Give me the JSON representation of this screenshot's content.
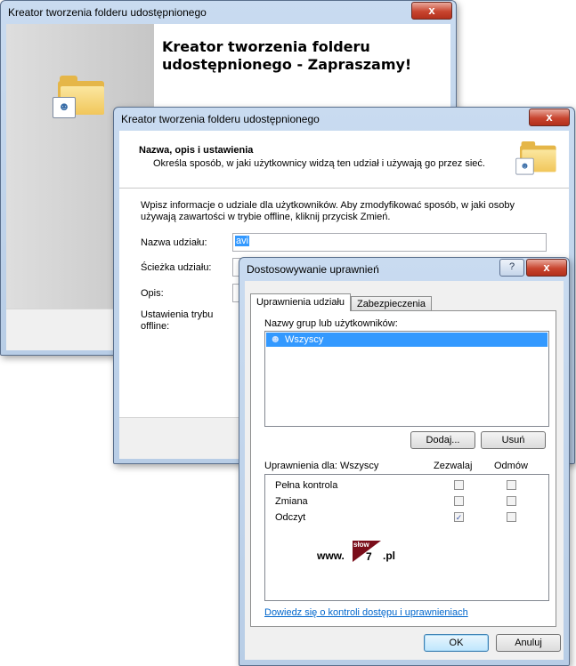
{
  "wizard1": {
    "title": "Kreator tworzenia folderu udostępnionego",
    "heading": "Kreator tworzenia folderu udostępnionego - Zapraszamy!",
    "close_label": "x"
  },
  "wizard2": {
    "title": "Kreator tworzenia folderu udostępnionego",
    "close_label": "x",
    "section_title": "Nazwa, opis i ustawienia",
    "section_desc": "Określa sposób, w jaki użytkownicy widzą ten udział i używają go przez sieć.",
    "instructions": "Wpisz informacje o udziale dla użytkowników. Aby zmodyfikować sposób, w jaki osoby używają zawartości w trybie offline, kliknij przycisk Zmień.",
    "fields": {
      "share_name_label": "Nazwa udziału:",
      "share_name_value": "avi",
      "share_path_label": "Ścieżka udziału:",
      "description_label": "Opis:",
      "offline_label": "Ustawienia trybu offline:"
    }
  },
  "permissions_dialog": {
    "title": "Dostosowywanie uprawnień",
    "help_label": "?",
    "close_label": "x",
    "tabs": [
      "Uprawnienia udziału",
      "Zabezpieczenia"
    ],
    "groups_label": "Nazwy grup lub użytkowników:",
    "groups": [
      "Wszyscy"
    ],
    "add_button": "Dodaj...",
    "remove_button": "Usuń",
    "permissions_for_label": "Uprawnienia dla: Wszyscy",
    "allow_header": "Zezwalaj",
    "deny_header": "Odmów",
    "permissions": [
      {
        "name": "Pełna kontrola",
        "allow": false,
        "deny": false
      },
      {
        "name": "Zmiana",
        "allow": false,
        "deny": false
      },
      {
        "name": "Odczyt",
        "allow": true,
        "deny": false
      }
    ],
    "help_link": "Dowiedz się o kontroli dostępu i uprawnieniach",
    "ok_button": "OK",
    "cancel_button": "Anuluj"
  },
  "watermark": {
    "prefix": "www.",
    "logo_top": "słow",
    "logo_number": "7",
    "suffix": ".pl"
  }
}
